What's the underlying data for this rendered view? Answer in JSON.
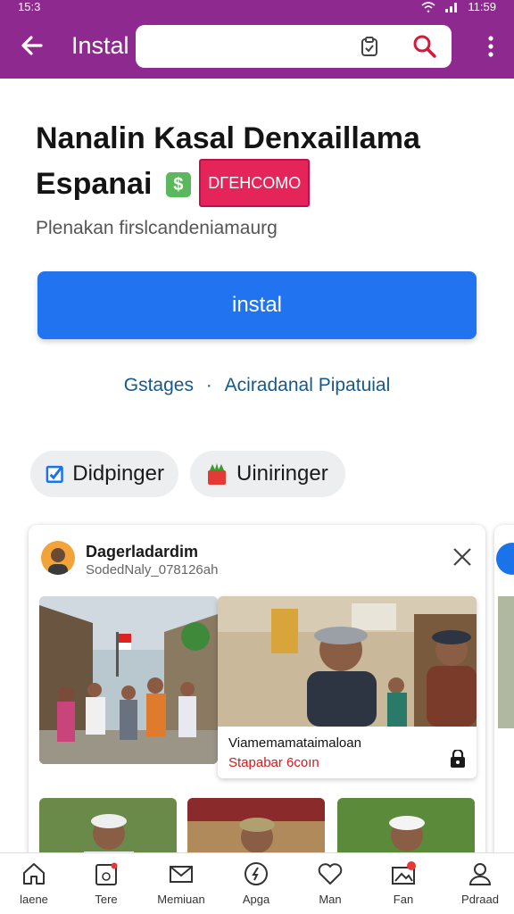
{
  "status_bar": {
    "time": "15:3",
    "right_time": "11:59"
  },
  "app_bar": {
    "title": "Instal",
    "search": {
      "value": "",
      "placeholder": ""
    },
    "back_icon": "arrow-left-icon",
    "clipboard_icon": "clipboard-icon",
    "search_icon": "search-icon",
    "more_icon": "more-vert-icon"
  },
  "app": {
    "title_line1": "Nanalin Kasal Denxaillama",
    "title_line2": "Espanai",
    "badge_text": "DΓEHCOMO",
    "subtitle": "Plenakan firslcandeniamaurg",
    "install_label": "instal",
    "link_left": "Gstages",
    "link_sep": "·",
    "link_right": "Aciradanal Pipatuial"
  },
  "chips": [
    {
      "label": "Didpinger",
      "icon": "checkbox-icon",
      "color": "#1a73e8"
    },
    {
      "label": "Uiniringer",
      "icon": "plant-pot-icon",
      "color": "#e53935"
    }
  ],
  "card": {
    "name": "Dagerladardim",
    "handle": "SodedNaly_078126ah",
    "caption_title": "Viamemamataimaloan",
    "caption_sub": "Stapabar 6coın"
  },
  "bottom_nav": [
    {
      "label": "laene",
      "icon": "home-icon"
    },
    {
      "label": "Tere",
      "icon": "calendar-icon"
    },
    {
      "label": "Memiuan",
      "icon": "mail-icon"
    },
    {
      "label": "Apga",
      "icon": "compass-icon"
    },
    {
      "label": "Man",
      "icon": "heart-icon"
    },
    {
      "label": "Fan",
      "icon": "image-icon"
    },
    {
      "label": "Pdraad",
      "icon": "profile-icon"
    }
  ],
  "colors": {
    "brand": "#8e2a8f",
    "primary": "#2173f0",
    "link": "#145a8a",
    "badge": "#e5245a"
  }
}
